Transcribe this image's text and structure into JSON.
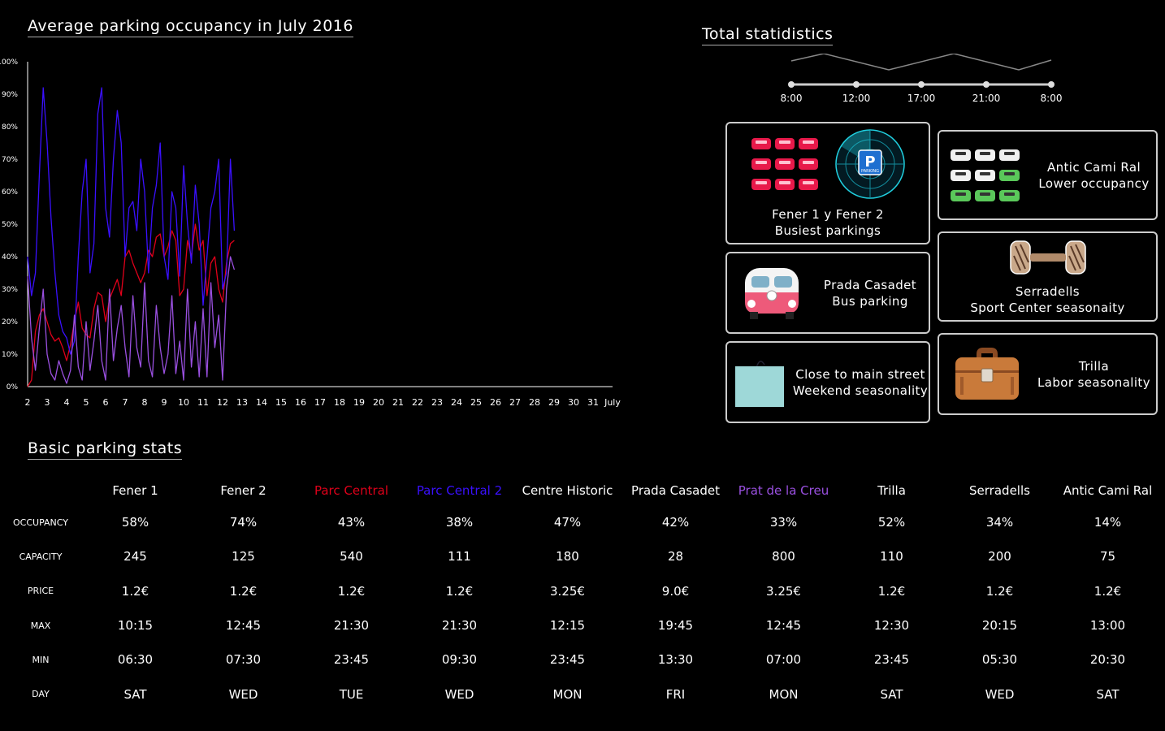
{
  "titles": {
    "chart": "Average parking occupancy in July 2016",
    "stats": "Total statidistics",
    "table": "Basic parking stats"
  },
  "colors": {
    "background": "#000000",
    "parc_central": "#e0001a",
    "parc_central_2": "#3a10ff",
    "prat_de_la_creu": "#9a50e0"
  },
  "chart_data": {
    "type": "line",
    "title": "Average parking occupancy in July 2016",
    "xlabel": "July",
    "x_ticks": [
      "2",
      "3",
      "4",
      "5",
      "6",
      "7",
      "8",
      "9",
      "10",
      "11",
      "12",
      "13",
      "14",
      "15",
      "16",
      "17",
      "18",
      "19",
      "20",
      "21",
      "22",
      "23",
      "24",
      "25",
      "26",
      "27",
      "28",
      "29",
      "30",
      "31",
      "July"
    ],
    "y_ticks": [
      "0%",
      "10%",
      "20%",
      "30%",
      "40%",
      "50%",
      "60%",
      "70%",
      "80%",
      "90%",
      "100%"
    ],
    "ylim": [
      0,
      100
    ],
    "xlim": [
      2,
      32
    ],
    "series": [
      {
        "name": "Parc Central",
        "color": "#e0001a",
        "x": [
          2,
          2.2,
          2.4,
          2.6,
          2.8,
          3,
          3.2,
          3.4,
          3.6,
          3.8,
          4,
          4.2,
          4.4,
          4.6,
          4.8,
          5,
          5.2,
          5.4,
          5.6,
          5.8,
          6,
          6.2,
          6.4,
          6.6,
          6.8,
          7,
          7.2,
          7.4,
          7.6,
          7.8,
          8,
          8.2,
          8.4,
          8.6,
          8.8,
          9,
          9.2,
          9.4,
          9.6,
          9.8,
          10,
          10.2,
          10.4,
          10.6,
          10.8,
          11,
          11.2,
          11.4,
          11.6,
          11.8,
          12,
          12.2,
          12.4,
          12.6
        ],
        "y": [
          0,
          2,
          17,
          22,
          24,
          20,
          16,
          14,
          15,
          12,
          8,
          13,
          20,
          26,
          18,
          16,
          15,
          24,
          29,
          28,
          20,
          27,
          30,
          33,
          28,
          40,
          42,
          38,
          35,
          32,
          35,
          42,
          40,
          46,
          47,
          40,
          43,
          48,
          45,
          28,
          30,
          45,
          40,
          50,
          42,
          45,
          28,
          38,
          40,
          30,
          26,
          38,
          44,
          45
        ]
      },
      {
        "name": "Parc Central 2",
        "color": "#3a10ff",
        "x": [
          2,
          2.2,
          2.4,
          2.6,
          2.8,
          3,
          3.2,
          3.4,
          3.6,
          3.8,
          4,
          4.2,
          4.4,
          4.6,
          4.8,
          5,
          5.2,
          5.4,
          5.6,
          5.8,
          6,
          6.2,
          6.4,
          6.6,
          6.8,
          7,
          7.2,
          7.4,
          7.6,
          7.8,
          8,
          8.2,
          8.4,
          8.6,
          8.8,
          9,
          9.2,
          9.4,
          9.6,
          9.8,
          10,
          10.2,
          10.4,
          10.6,
          10.8,
          11,
          11.2,
          11.4,
          11.6,
          11.8,
          12,
          12.2,
          12.4,
          12.6
        ],
        "y": [
          40,
          28,
          35,
          65,
          92,
          75,
          52,
          35,
          22,
          17,
          15,
          10,
          14,
          40,
          60,
          70,
          35,
          44,
          84,
          92,
          55,
          46,
          70,
          85,
          75,
          40,
          55,
          57,
          48,
          70,
          60,
          35,
          55,
          62,
          75,
          40,
          33,
          60,
          55,
          34,
          68,
          50,
          38,
          62,
          50,
          25,
          40,
          55,
          60,
          70,
          30,
          35,
          70,
          48
        ]
      },
      {
        "name": "Prat de la Creu",
        "color": "#9a50e0",
        "x": [
          2,
          2.2,
          2.4,
          2.6,
          2.8,
          3,
          3.2,
          3.4,
          3.6,
          3.8,
          4,
          4.2,
          4.4,
          4.6,
          4.8,
          5,
          5.2,
          5.4,
          5.6,
          5.8,
          6,
          6.2,
          6.4,
          6.6,
          6.8,
          7,
          7.2,
          7.4,
          7.6,
          7.8,
          8,
          8.2,
          8.4,
          8.6,
          8.8,
          9,
          9.2,
          9.4,
          9.6,
          9.8,
          10,
          10.2,
          10.4,
          10.6,
          10.8,
          11,
          11.2,
          11.4,
          11.6,
          11.8,
          12,
          12.2,
          12.4,
          12.6
        ],
        "y": [
          34,
          15,
          5,
          18,
          30,
          10,
          4,
          2,
          8,
          4,
          1,
          5,
          22,
          6,
          2,
          20,
          5,
          14,
          25,
          8,
          2,
          30,
          8,
          18,
          25,
          12,
          3,
          28,
          12,
          6,
          32,
          8,
          3,
          25,
          12,
          4,
          10,
          28,
          4,
          14,
          2,
          30,
          6,
          20,
          3,
          24,
          3,
          32,
          12,
          22,
          2,
          30,
          40,
          36
        ]
      }
    ]
  },
  "timeline": {
    "labels": [
      "8:00",
      "12:00",
      "17:00",
      "21:00",
      "8:00"
    ]
  },
  "cards": [
    {
      "id": "fener",
      "line1": "Fener 1 y Fener 2",
      "line2": "Busiest parkings",
      "parking_sign": "P",
      "parking_word": "PARKING"
    },
    {
      "id": "antic",
      "line1": "Antic Cami Ral",
      "line2": "Lower occupancy"
    },
    {
      "id": "prada",
      "line1": "Prada Casadet",
      "line2": "Bus parking"
    },
    {
      "id": "serradells",
      "line1": "Serradells",
      "line2": "Sport Center seasonaity"
    },
    {
      "id": "main-street",
      "line1": "Close to main street",
      "line2": "Weekend seasonality"
    },
    {
      "id": "trilla",
      "line1": "Trilla",
      "line2": "Labor seasonality"
    }
  ],
  "table": {
    "columns": [
      "Fener 1",
      "Fener 2",
      "Parc Central",
      "Parc Central 2",
      "Centre Historic",
      "Prada Casadet",
      "Prat de la Creu",
      "Trilla",
      "Serradells",
      "Antic Cami Ral"
    ],
    "column_colors": [
      "#ffffff",
      "#ffffff",
      "#e0001a",
      "#3a10ff",
      "#ffffff",
      "#ffffff",
      "#9a50e0",
      "#ffffff",
      "#ffffff",
      "#ffffff"
    ],
    "rows": [
      {
        "label": "OCCUPANCY",
        "values": [
          "58%",
          "74%",
          "43%",
          "38%",
          "47%",
          "42%",
          "33%",
          "52%",
          "34%",
          "14%"
        ]
      },
      {
        "label": "CAPACITY",
        "values": [
          "245",
          "125",
          "540",
          "111",
          "180",
          "28",
          "800",
          "110",
          "200",
          "75"
        ]
      },
      {
        "label": "PRICE",
        "values": [
          "1.2€",
          "1.2€",
          "1.2€",
          "1.2€",
          "3.25€",
          "9.0€",
          "3.25€",
          "1.2€",
          "1.2€",
          "1.2€"
        ]
      },
      {
        "label": "MAX",
        "values": [
          "10:15",
          "12:45",
          "21:30",
          "21:30",
          "12:15",
          "19:45",
          "12:45",
          "12:30",
          "20:15",
          "13:00"
        ]
      },
      {
        "label": "MIN",
        "values": [
          "06:30",
          "07:30",
          "23:45",
          "09:30",
          "23:45",
          "13:30",
          "07:00",
          "23:45",
          "05:30",
          "20:30"
        ]
      },
      {
        "label": "DAY",
        "values": [
          "SAT",
          "WED",
          "TUE",
          "WED",
          "MON",
          "FRI",
          "MON",
          "SAT",
          "WED",
          "SAT"
        ]
      }
    ]
  }
}
